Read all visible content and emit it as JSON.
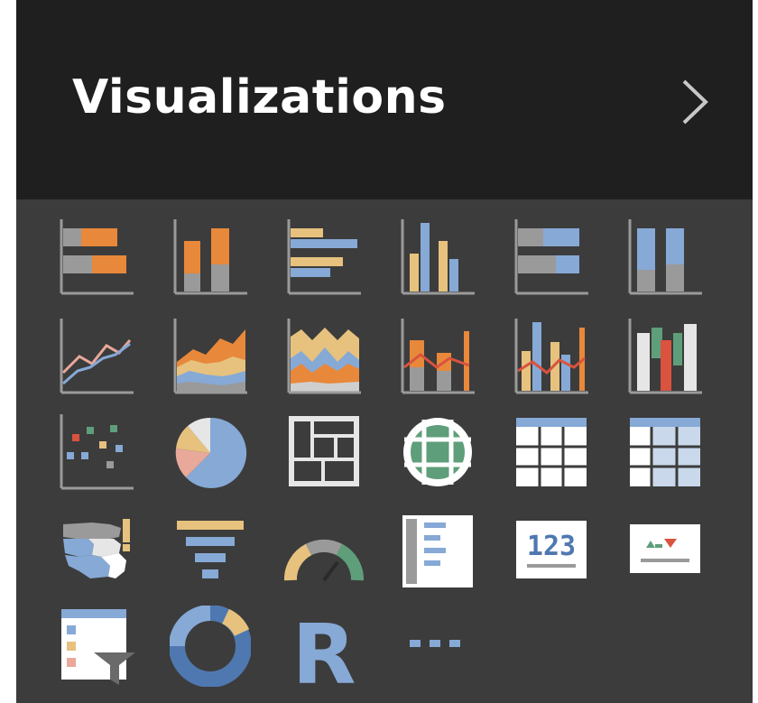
{
  "pane": {
    "title": "Visualizations",
    "expand_glyph": "›"
  },
  "colors": {
    "header_bg": "#1f1f1f",
    "grid_bg": "#3c3c3c",
    "orange": "#e8883a",
    "tan": "#e6c27e",
    "blue": "#86a9d6",
    "gray": "#9a9a9a",
    "red": "#d9533e",
    "teal": "#5f9e7a"
  },
  "visual_icons": [
    {
      "name": "stacked-bar-chart-icon"
    },
    {
      "name": "stacked-column-chart-icon"
    },
    {
      "name": "clustered-bar-chart-icon"
    },
    {
      "name": "clustered-column-chart-icon"
    },
    {
      "name": "100-stacked-bar-chart-icon"
    },
    {
      "name": "100-stacked-column-chart-icon"
    },
    {
      "name": "line-chart-icon"
    },
    {
      "name": "area-chart-icon"
    },
    {
      "name": "stacked-area-chart-icon"
    },
    {
      "name": "line-and-stacked-column-chart-icon"
    },
    {
      "name": "line-and-clustered-column-chart-icon"
    },
    {
      "name": "waterfall-chart-icon"
    },
    {
      "name": "scatter-chart-icon"
    },
    {
      "name": "pie-chart-icon"
    },
    {
      "name": "treemap-icon"
    },
    {
      "name": "map-icon"
    },
    {
      "name": "table-icon"
    },
    {
      "name": "matrix-icon"
    },
    {
      "name": "filled-map-icon"
    },
    {
      "name": "funnel-icon"
    },
    {
      "name": "gauge-icon"
    },
    {
      "name": "multi-row-card-icon"
    },
    {
      "name": "card-icon"
    },
    {
      "name": "kpi-icon"
    },
    {
      "name": "slicer-icon"
    },
    {
      "name": "donut-chart-icon"
    },
    {
      "name": "r-script-visual-icon"
    },
    {
      "name": "more-visuals-icon"
    }
  ],
  "card_text": "123",
  "r_text": "R"
}
